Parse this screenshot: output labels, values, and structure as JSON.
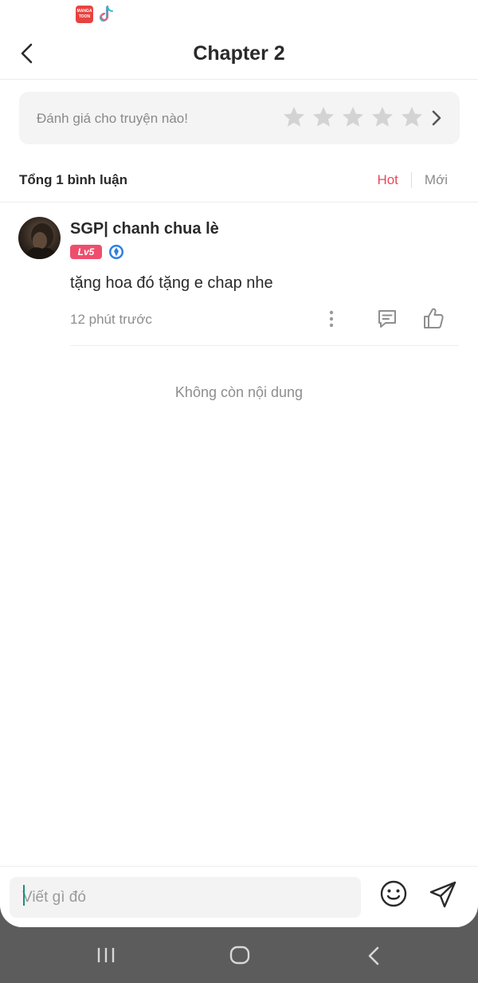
{
  "status_bar": {
    "apps": [
      {
        "name": "mangatoon-icon",
        "label": "MANGA TOON"
      },
      {
        "name": "tiktok-icon"
      }
    ]
  },
  "header": {
    "title": "Chapter 2",
    "back_icon": "chevron-left-icon"
  },
  "rating": {
    "prompt": "Đánh giá cho truyện nào!",
    "stars": 5,
    "star_color": "#d3d3d3",
    "chevron_icon": "chevron-right-icon"
  },
  "comments_header": {
    "total": "Tổng 1 bình luận",
    "sort_hot": "Hot",
    "sort_new": "Mới",
    "active_color": "#e8475a"
  },
  "comments": [
    {
      "username": "SGP| chanh chua lè",
      "level": "Lv5",
      "level_color": "#ee4e6c",
      "verify_icon": "badge-icon",
      "text": "tặng hoa đó tặng e chap nhe",
      "time": "12 phút trước",
      "actions": [
        "more-icon",
        "reply-icon",
        "like-icon"
      ]
    }
  ],
  "empty_message": "Không còn nội dung",
  "input": {
    "placeholder": "Viết gì đó",
    "emoji_icon": "smiley-icon",
    "send_icon": "send-icon"
  },
  "nav_bar": {
    "buttons": [
      "recents-icon",
      "home-icon",
      "back-icon"
    ]
  }
}
